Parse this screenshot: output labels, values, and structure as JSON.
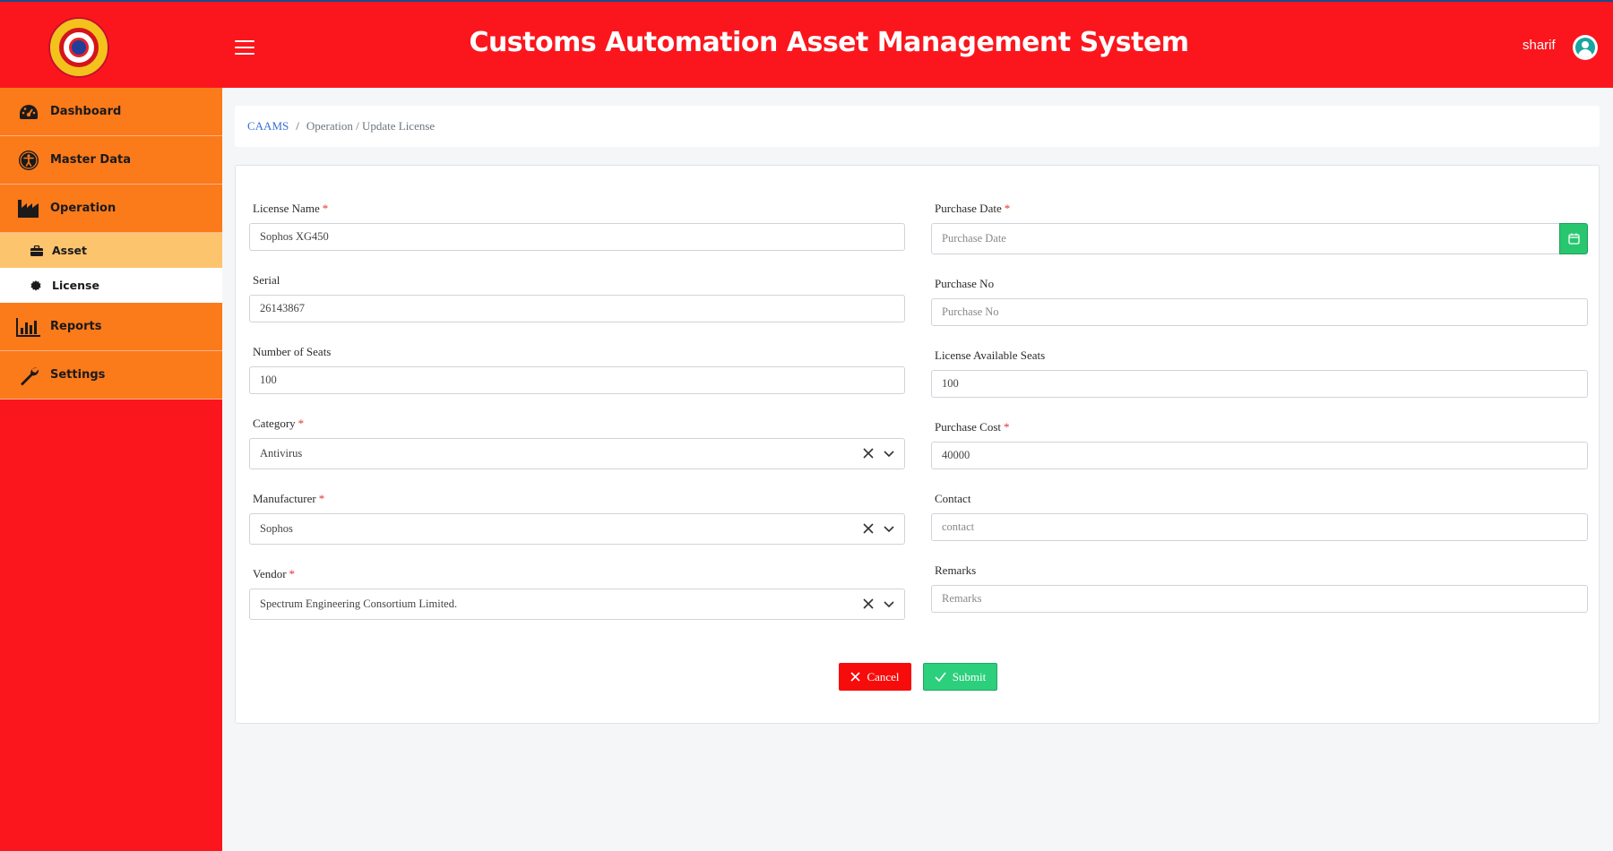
{
  "header": {
    "title": "Customs Automation Asset Management System",
    "user_name": "sharif"
  },
  "sidebar": {
    "items": [
      {
        "label": "Dashboard",
        "icon": "dashboard-icon"
      },
      {
        "label": "Master Data",
        "icon": "accessibility-icon"
      },
      {
        "label": "Operation",
        "icon": "factory-icon"
      },
      {
        "label": "Reports",
        "icon": "bar-chart-icon"
      },
      {
        "label": "Settings",
        "icon": "wrench-icon"
      }
    ],
    "operation_subitems": [
      {
        "label": "Asset",
        "icon": "briefcase-icon"
      },
      {
        "label": "License",
        "icon": "badge-icon"
      }
    ]
  },
  "breadcrumb": {
    "root": "CAAMS",
    "separator": "/",
    "path": "Operation / Update License"
  },
  "form": {
    "license_name": {
      "label": "License Name",
      "value": "Sophos XG450"
    },
    "serial": {
      "label": "Serial",
      "value": "26143867"
    },
    "number_of_seats": {
      "label": "Number of Seats",
      "value": "100"
    },
    "category": {
      "label": "Category",
      "value": "Antivirus"
    },
    "manufacturer": {
      "label": "Manufacturer",
      "value": "Sophos"
    },
    "vendor": {
      "label": "Vendor",
      "value": "Spectrum Engineering Consortium Limited."
    },
    "purchase_date": {
      "label": "Purchase Date",
      "placeholder": "Purchase Date"
    },
    "purchase_no": {
      "label": "Purchase No",
      "placeholder": "Purchase No"
    },
    "license_available_seats": {
      "label": "License Available Seats",
      "value": "100"
    },
    "purchase_cost": {
      "label": "Purchase Cost",
      "value": "40000"
    },
    "contact": {
      "label": "Contact",
      "placeholder": "contact"
    },
    "remarks": {
      "label": "Remarks",
      "placeholder": "Remarks"
    },
    "required_marker": "*"
  },
  "actions": {
    "cancel_label": "Cancel",
    "submit_label": "Submit"
  },
  "colors": {
    "header_bg": "#fb161d",
    "nav_bg": "#fb7a1a",
    "active_sub_bg": "#fdc46e",
    "cancel": "#f70c0c",
    "submit": "#2bcf7c",
    "link": "#3b6fd8"
  }
}
